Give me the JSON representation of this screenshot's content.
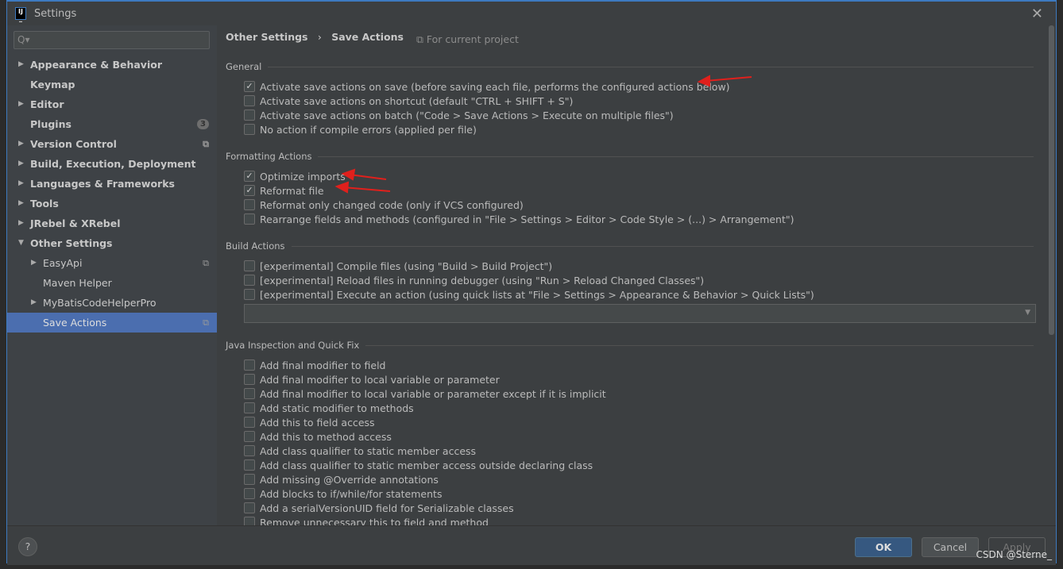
{
  "window": {
    "title": "Settings"
  },
  "sidebar": {
    "search_placeholder": "Q▾",
    "items": [
      {
        "label": "Appearance & Behavior",
        "arrow": "▶"
      },
      {
        "label": "Keymap"
      },
      {
        "label": "Editor",
        "arrow": "▶"
      },
      {
        "label": "Plugins",
        "badge": "3"
      },
      {
        "label": "Version Control",
        "arrow": "▶"
      },
      {
        "label": "Build, Execution, Deployment",
        "arrow": "▶"
      },
      {
        "label": "Languages & Frameworks",
        "arrow": "▶"
      },
      {
        "label": "Tools",
        "arrow": "▶"
      },
      {
        "label": "JRebel & XRebel",
        "arrow": "▶"
      },
      {
        "label": "Other Settings",
        "arrow": "▼"
      },
      {
        "label": "EasyApi",
        "arrow": "▶"
      },
      {
        "label": "Maven Helper"
      },
      {
        "label": "MyBatisCodeHelperPro",
        "arrow": "▶"
      },
      {
        "label": "Save Actions",
        "selected": true
      }
    ]
  },
  "breadcrumb": {
    "parent": "Other Settings",
    "sep": "›",
    "current": "Save Actions",
    "scope": "⧉ For current project"
  },
  "sections": [
    {
      "title": "General",
      "items": [
        {
          "label": "Activate save actions on save (before saving each file, performs the configured actions below)",
          "checked": true
        },
        {
          "label": "Activate save actions on shortcut (default \"CTRL + SHIFT + S\")",
          "checked": false
        },
        {
          "label": "Activate save actions on batch (\"Code > Save Actions > Execute on multiple files\")",
          "checked": false
        },
        {
          "label": "No action if compile errors (applied per file)",
          "checked": false
        }
      ]
    },
    {
      "title": "Formatting Actions",
      "items": [
        {
          "label": "Optimize imports",
          "checked": true
        },
        {
          "label": "Reformat file",
          "checked": true
        },
        {
          "label": "Reformat only changed code (only if VCS configured)",
          "checked": false
        },
        {
          "label": "Rearrange fields and methods (configured in \"File > Settings > Editor > Code Style > (...) > Arrangement\")",
          "checked": false
        }
      ]
    },
    {
      "title": "Build Actions",
      "items": [
        {
          "label": "[experimental] Compile files (using \"Build > Build Project\")",
          "checked": false
        },
        {
          "label": "[experimental] Reload files in running debugger (using \"Run > Reload Changed Classes\")",
          "checked": false
        },
        {
          "label": "[experimental] Execute an action (using quick lists at \"File > Settings > Appearance & Behavior > Quick Lists\")",
          "checked": false
        }
      ]
    },
    {
      "title": "Java Inspection and Quick Fix",
      "items": [
        {
          "label": "Add final modifier to field",
          "checked": false
        },
        {
          "label": "Add final modifier to local variable or parameter",
          "checked": false
        },
        {
          "label": "Add final modifier to local variable or parameter except if it is implicit",
          "checked": false
        },
        {
          "label": "Add static modifier to methods",
          "checked": false
        },
        {
          "label": "Add this to field access",
          "checked": false
        },
        {
          "label": "Add this to method access",
          "checked": false
        },
        {
          "label": "Add class qualifier to static member access",
          "checked": false
        },
        {
          "label": "Add class qualifier to static member access outside declaring class",
          "checked": false
        },
        {
          "label": "Add missing @Override annotations",
          "checked": false
        },
        {
          "label": "Add blocks to if/while/for statements",
          "checked": false
        },
        {
          "label": "Add a serialVersionUID field for Serializable classes",
          "checked": false
        },
        {
          "label": "Remove unnecessary this to field and method",
          "checked": false
        }
      ]
    }
  ],
  "buttons": {
    "help": "?",
    "ok": "OK",
    "cancel": "Cancel",
    "apply": "Apply"
  },
  "watermark": "CSDN @Sterne_",
  "colors": {
    "accent": "#4b6eaf",
    "ok": "#365880",
    "annotation_arrow": "#e0201c"
  }
}
